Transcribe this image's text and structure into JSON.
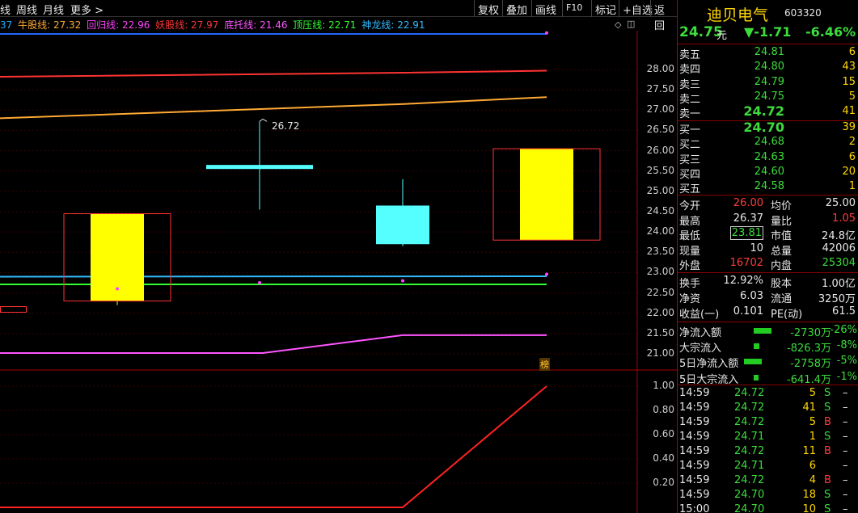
{
  "toolbar": {
    "left_items": [
      "线",
      "周线",
      "月线",
      "更多 >"
    ],
    "buttons": [
      "复权",
      "叠加",
      "画线",
      "F10",
      "标记",
      "+自选",
      "返回"
    ]
  },
  "legend": [
    {
      "label": "37",
      "color": "#22aaff"
    },
    {
      "label": "牛股线: 27.32",
      "color": "#ffaa33"
    },
    {
      "label": "回归线: 22.96",
      "color": "#ff44ff"
    },
    {
      "label": "妖股线: 27.97",
      "color": "#ff3333"
    },
    {
      "label": "底托线: 21.46",
      "color": "#ff55ff"
    },
    {
      "label": "顶压线: 22.71",
      "color": "#33ff33"
    },
    {
      "label": "神龙线: 22.91",
      "color": "#33bbff"
    }
  ],
  "chart": {
    "price_ticks": [
      "28.00",
      "27.50",
      "27.00",
      "26.50",
      "26.00",
      "25.50",
      "25.00",
      "24.50",
      "24.00",
      "23.50",
      "23.00",
      "22.50",
      "22.00",
      "21.50",
      "21.00"
    ],
    "sub_ticks": [
      "1.00",
      "0.80",
      "0.60",
      "0.40",
      "0.20"
    ],
    "high_label": "26.72",
    "badge": "榜",
    "colors": {
      "up": "#ffff00",
      "down": "#55ffff",
      "box": "#ff3333"
    },
    "chart_data": {
      "type": "candlestick",
      "price_axis": {
        "min": 21.0,
        "max": 28.0
      },
      "candles": [
        {
          "open": 22.3,
          "close": 24.45,
          "high": 24.45,
          "low": 22.2,
          "direction": "up"
        },
        {
          "open": 25.65,
          "close": 25.55,
          "high": 26.72,
          "low": 24.55,
          "direction": "down"
        },
        {
          "open": 24.65,
          "close": 23.7,
          "high": 25.3,
          "low": 23.65,
          "direction": "down"
        },
        {
          "open": 23.8,
          "close": 26.05,
          "high": 26.05,
          "low": 23.8,
          "direction": "up"
        }
      ],
      "lines": [
        {
          "name": "妖股线",
          "value": 27.97,
          "color": "#ff3333"
        },
        {
          "name": "牛股线",
          "value": 27.32,
          "color": "#ffaa33"
        },
        {
          "name": "神龙线",
          "value": 22.91,
          "color": "#33bbff"
        },
        {
          "name": "顶压线",
          "value": 22.71,
          "color": "#33ff33"
        },
        {
          "name": "底托线",
          "value": 21.46,
          "color": "#ff55ff"
        }
      ],
      "sub_indicator": {
        "range": [
          0,
          1.0
        ],
        "values": [
          0,
          0,
          0,
          1.0
        ],
        "color": "#ff2222"
      }
    }
  },
  "quote": {
    "name": "迪贝电气",
    "code": "603320",
    "price": "24.75",
    "unit": "元",
    "change": "▼-1.71",
    "pct": "-6.46%"
  },
  "sells": [
    {
      "label": "卖五",
      "price": "24.81",
      "vol": "6"
    },
    {
      "label": "卖四",
      "price": "24.80",
      "vol": "43"
    },
    {
      "label": "卖三",
      "price": "24.79",
      "vol": "15"
    },
    {
      "label": "卖二",
      "price": "24.75",
      "vol": "5"
    },
    {
      "label": "卖一",
      "price": "24.72",
      "vol": "41"
    }
  ],
  "buys": [
    {
      "label": "买一",
      "price": "24.70",
      "vol": "39"
    },
    {
      "label": "买二",
      "price": "24.68",
      "vol": "2"
    },
    {
      "label": "买三",
      "price": "24.63",
      "vol": "6"
    },
    {
      "label": "买四",
      "price": "24.60",
      "vol": "20"
    },
    {
      "label": "买五",
      "price": "24.58",
      "vol": "1"
    }
  ],
  "stats1": [
    {
      "l1": "今开",
      "v1": "26.00",
      "l2": "均价",
      "v2": "25.00"
    },
    {
      "l1": "最高",
      "v1": "26.37",
      "l2": "量比",
      "v2": "1.05"
    },
    {
      "l1": "最低",
      "v1": "23.81",
      "l2": "市值",
      "v2": "24.8亿"
    },
    {
      "l1": "现量",
      "v1": "10",
      "l2": "总量",
      "v2": "42006"
    },
    {
      "l1": "外盘",
      "v1": "16702",
      "l2": "内盘",
      "v2": "25304"
    }
  ],
  "stats2": [
    {
      "l1": "换手",
      "v1": "12.92%",
      "l2": "股本",
      "v2": "1.00亿"
    },
    {
      "l1": "净资",
      "v1": "6.03",
      "l2": "流通",
      "v2": "3250万"
    },
    {
      "l1": "收益(一)",
      "v1": "0.101",
      "l2": "PE(动)",
      "v2": "61.5"
    }
  ],
  "flows": [
    {
      "label": "净流入额",
      "value": "-2730万",
      "pct": "-26%",
      "bar": 1.0
    },
    {
      "label": "大宗流入",
      "value": "-826.3万",
      "pct": "-8%",
      "bar": 0.3
    },
    {
      "label": "5日净流入额",
      "value": "-2758万",
      "pct": "-5%",
      "bar": 1.0
    },
    {
      "label": "5日大宗流入",
      "value": "-641.4万",
      "pct": "-1%",
      "bar": 0.25
    }
  ],
  "ticks": [
    {
      "time": "14:59",
      "price": "24.72",
      "vol": "5",
      "side": "S"
    },
    {
      "time": "14:59",
      "price": "24.72",
      "vol": "41",
      "side": "S"
    },
    {
      "time": "14:59",
      "price": "24.72",
      "vol": "5",
      "side": "B"
    },
    {
      "time": "14:59",
      "price": "24.71",
      "vol": "1",
      "side": "S"
    },
    {
      "time": "14:59",
      "price": "24.72",
      "vol": "11",
      "side": "B"
    },
    {
      "time": "14:59",
      "price": "24.71",
      "vol": "6",
      "side": ""
    },
    {
      "time": "14:59",
      "price": "24.72",
      "vol": "4",
      "side": "B"
    },
    {
      "time": "14:59",
      "price": "24.70",
      "vol": "18",
      "side": "S"
    },
    {
      "time": "15:00",
      "price": "24.70",
      "vol": "10",
      "side": "S"
    }
  ]
}
